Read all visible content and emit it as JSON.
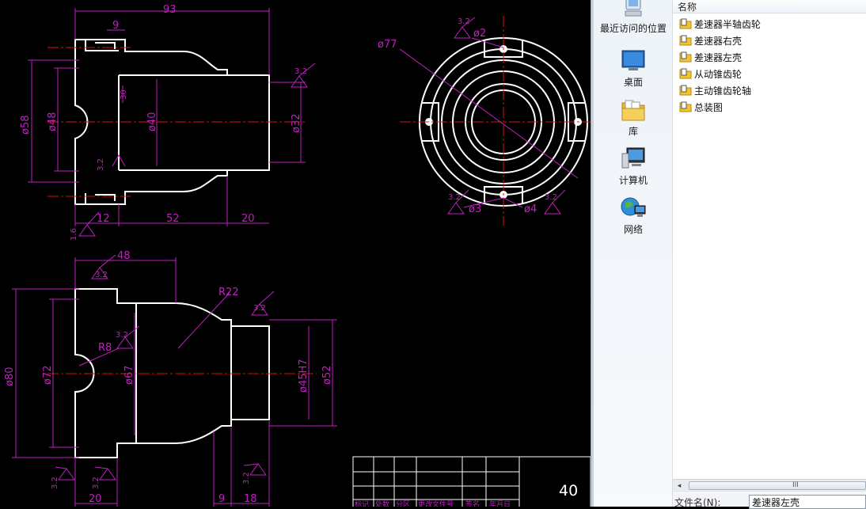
{
  "drawing": {
    "view1": {
      "dims": [
        "93",
        "9",
        "ø58",
        "ø48",
        "ø40",
        "30",
        "ø32",
        "12",
        "52",
        "20"
      ],
      "roughness": [
        "3.2",
        "3.2",
        "3.2",
        "1.6"
      ]
    },
    "view2": {
      "dims": [
        "ø77",
        "ø2",
        "ø3",
        "ø4"
      ],
      "roughness": [
        "3.2",
        "3.2",
        "3.2"
      ]
    },
    "view3": {
      "dims": [
        "48",
        "R22",
        "R8",
        "ø80",
        "ø72",
        "ø67",
        "ø45H7",
        "ø52",
        "20",
        "9",
        "18"
      ],
      "roughness": [
        "3.2",
        "3.2",
        "3.2",
        "3.2",
        "3.2",
        "3.2"
      ]
    },
    "title_block": {
      "headers": [
        "标记",
        "处数",
        "分区",
        "更改文件号",
        "签名",
        "年月日"
      ],
      "sheet_number": "40"
    }
  },
  "nav": {
    "items": [
      {
        "label": "最近访问的位置",
        "icon": "recent-places-icon"
      },
      {
        "label": "桌面",
        "icon": "desktop-icon"
      },
      {
        "label": "库",
        "icon": "library-icon"
      },
      {
        "label": "计算机",
        "icon": "computer-icon"
      },
      {
        "label": "网络",
        "icon": "network-icon"
      }
    ]
  },
  "file_list": {
    "column_name": "名称",
    "files": [
      "差速器半轴齿轮",
      "差速器右壳",
      "差速器左壳",
      "从动锥齿轮",
      "主动锥齿轮轴",
      "总装图"
    ]
  },
  "footer": {
    "filename_label": "文件名(N):",
    "filename_value": "差速器左壳",
    "scrollbar_grip": "III"
  },
  "colors": {
    "background": "#000000",
    "outline": "#ffffff",
    "dimension": "#c21fc2",
    "centerline": "#e01010",
    "folder": "#f3c431"
  }
}
